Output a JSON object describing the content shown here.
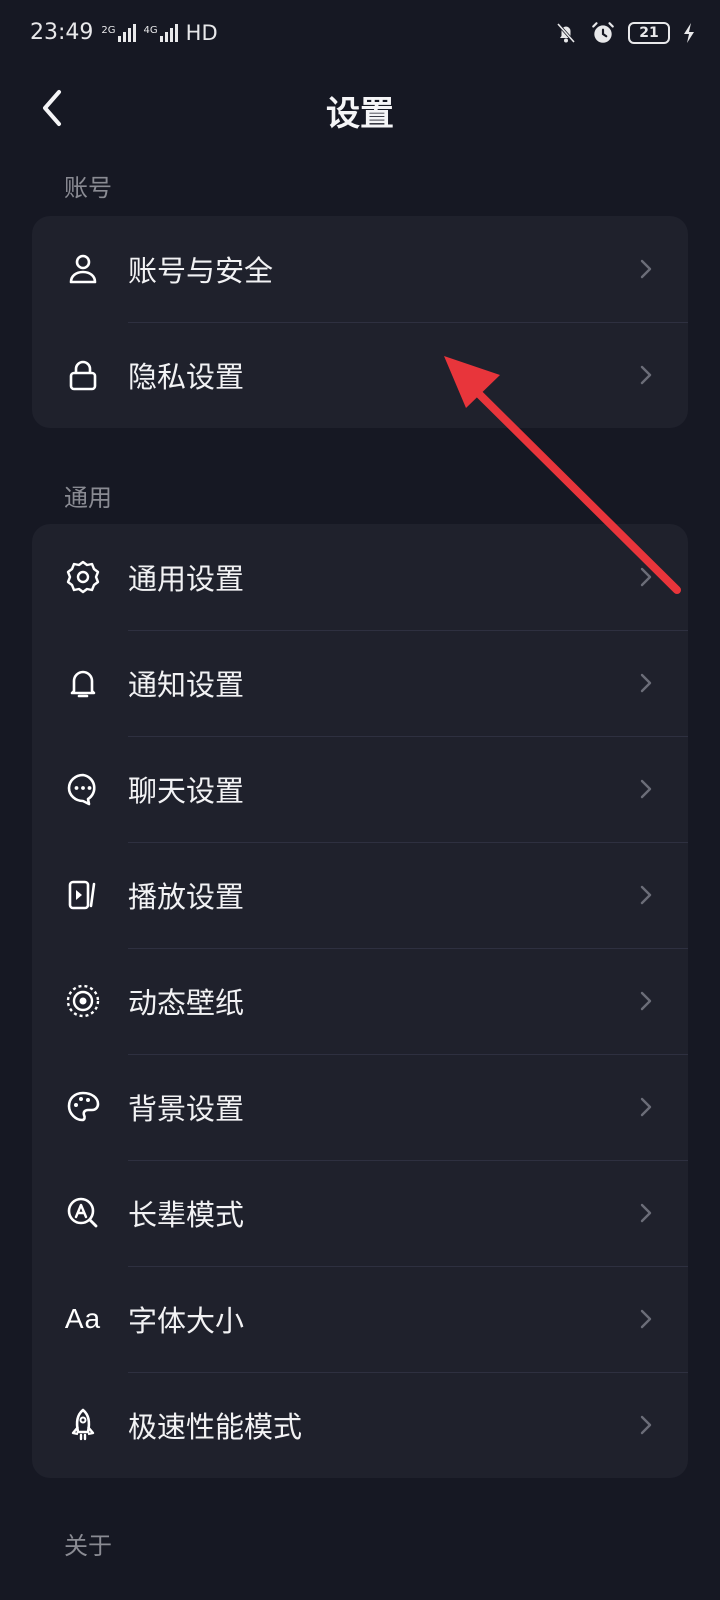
{
  "status_bar": {
    "time": "23:49",
    "net1": "2G",
    "net2": "4G",
    "hd": "HD",
    "battery": "21"
  },
  "header": {
    "title": "设置"
  },
  "sections": [
    {
      "label": "账号",
      "items": [
        {
          "label": "账号与安全",
          "icon": "user-icon"
        },
        {
          "label": "隐私设置",
          "icon": "lock-icon"
        }
      ]
    },
    {
      "label": "通用",
      "items": [
        {
          "label": "通用设置",
          "icon": "gear-icon"
        },
        {
          "label": "通知设置",
          "icon": "bell-icon"
        },
        {
          "label": "聊天设置",
          "icon": "chat-bubble-icon"
        },
        {
          "label": "播放设置",
          "icon": "play-icon"
        },
        {
          "label": "动态壁纸",
          "icon": "live-wallpaper-icon"
        },
        {
          "label": "背景设置",
          "icon": "palette-icon"
        },
        {
          "label": "长辈模式",
          "icon": "elder-mode-icon"
        },
        {
          "label": "字体大小",
          "icon": "font-size-icon",
          "icon_text": "Aa"
        },
        {
          "label": "极速性能模式",
          "icon": "rocket-icon"
        }
      ]
    },
    {
      "label": "关于"
    }
  ],
  "colors": {
    "background": "#161823",
    "card": "#1f212c",
    "annotation_arrow": "#e8353b"
  }
}
